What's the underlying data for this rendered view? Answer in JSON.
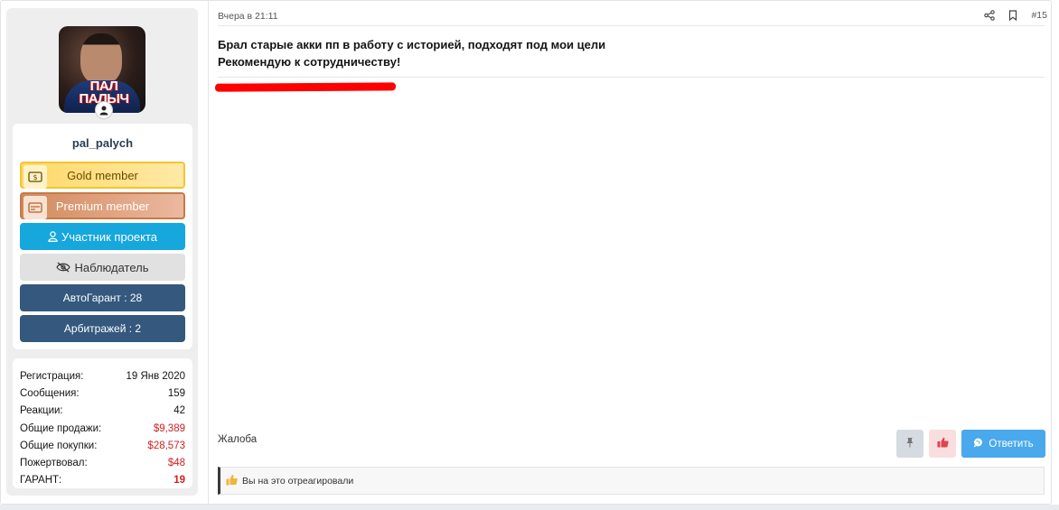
{
  "user": {
    "name": "pal_palych",
    "avatar_text_line1": "ПАЛ",
    "avatar_text_line2": "ПАЛЫЧ"
  },
  "banners": {
    "gold": "Gold member",
    "premium": "Premium member",
    "member": "Участник проекта",
    "watcher": "Наблюдатель",
    "autogarant": "АвтоГарант : 28",
    "arbitrations": "Арбитражей : 2"
  },
  "stats": [
    {
      "label": "Регистрация:",
      "value": "19 Янв 2020"
    },
    {
      "label": "Сообщения:",
      "value": "159"
    },
    {
      "label": "Реакции:",
      "value": "42"
    },
    {
      "label": "Общие продажи:",
      "value": "$9,389"
    },
    {
      "label": "Общие покупки:",
      "value": "$28,573"
    },
    {
      "label": "Пожертвовал:",
      "value": "$48"
    },
    {
      "label": "ГАРАНТ:",
      "value": "19"
    }
  ],
  "post": {
    "time": "Вчера в 21:11",
    "number": "#15",
    "line1": "Брал старые акки пп в работу с историей, подходят под мои цели",
    "line2": "Рекомендую к сотрудничеству!",
    "complaint": "Жалоба",
    "reply": "Ответить",
    "reactions_text": "Вы на это отреагировали"
  },
  "colors": {
    "accent_blue": "#49a9ec",
    "member_blue": "#16a7dd",
    "navy": "#34587e",
    "money_red": "#d31f1f",
    "redaction": "#ff0000"
  }
}
